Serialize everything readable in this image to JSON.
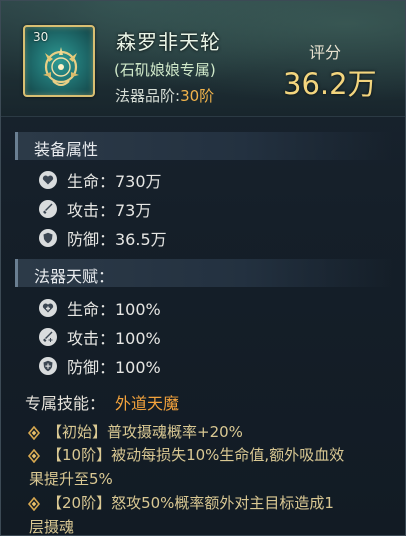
{
  "item": {
    "level": "30",
    "name": "森罗非天轮",
    "owner": "(石矶娘娘专属)",
    "grade_label": "法器品阶:",
    "grade_value": "30阶",
    "icon": "sun-wheel-icon"
  },
  "score": {
    "label": "评分",
    "value": "36.2万"
  },
  "equip_attrs": {
    "title": "装备属性",
    "stats": [
      {
        "icon": "heart-icon",
        "text": "生命：730万"
      },
      {
        "icon": "sword-icon",
        "text": "攻击：73万"
      },
      {
        "icon": "shield-icon",
        "text": "防御：36.5万"
      }
    ]
  },
  "talent": {
    "title": "法器天赋：",
    "stats": [
      {
        "icon": "heart-plus-icon",
        "text": "生命：100%"
      },
      {
        "icon": "sword-plus-icon",
        "text": "攻击：100%"
      },
      {
        "icon": "shield-plus-icon",
        "text": "防御：100%"
      }
    ]
  },
  "skill": {
    "label": "专属技能：",
    "name": "外道天魔",
    "lines": [
      "【初始】普攻摄魂概率+20%",
      "【10阶】被动每损失10%生命值,额外吸血效",
      "果提升至5%",
      "【20阶】怒攻50%概率额外对主目标造成1",
      "层摄魂"
    ]
  },
  "colors": {
    "frame_gold": "#d9bf72",
    "grade_orange": "#f0b34b",
    "score_gold": "#f3d57e",
    "skill_name": "#f2a23c",
    "skill_text": "#d9c893"
  }
}
